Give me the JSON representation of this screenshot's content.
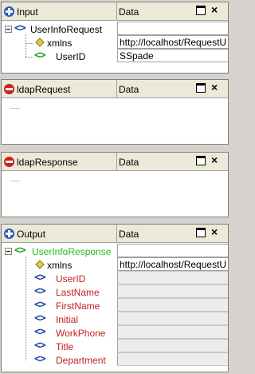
{
  "panels": {
    "input": {
      "title": "Input",
      "data_header": "Data",
      "root": "UserInfoRequest",
      "children": [
        {
          "label": "xmlns",
          "value": "http://localhost/RequestU"
        },
        {
          "label": "UserID",
          "value": "SSpade"
        }
      ]
    },
    "ldap_request": {
      "title": "ldapRequest",
      "data_header": "Data"
    },
    "ldap_response": {
      "title": "ldapResponse",
      "data_header": "Data"
    },
    "output": {
      "title": "Output",
      "data_header": "Data",
      "root": "UserInfoResponse",
      "children": [
        {
          "label": "xmlns",
          "value": "http://localhost/RequestU"
        },
        {
          "label": "UserID",
          "value": ""
        },
        {
          "label": "LastName",
          "value": ""
        },
        {
          "label": "FirstName",
          "value": ""
        },
        {
          "label": "Initial",
          "value": ""
        },
        {
          "label": "WorkPhone",
          "value": ""
        },
        {
          "label": "Title",
          "value": ""
        },
        {
          "label": "Department",
          "value": ""
        }
      ]
    }
  },
  "icons": {
    "panel_close": "close-icon",
    "panel_pin": "minimize-icon",
    "element": "xml-element-icon",
    "attribute": "xml-attribute-icon"
  },
  "colors": {
    "element_icon": "#1a3fa8",
    "mapped_element_icon": "#1ea01e",
    "unmapped_label": "#c42020",
    "root_output_label": "#22bb22"
  }
}
